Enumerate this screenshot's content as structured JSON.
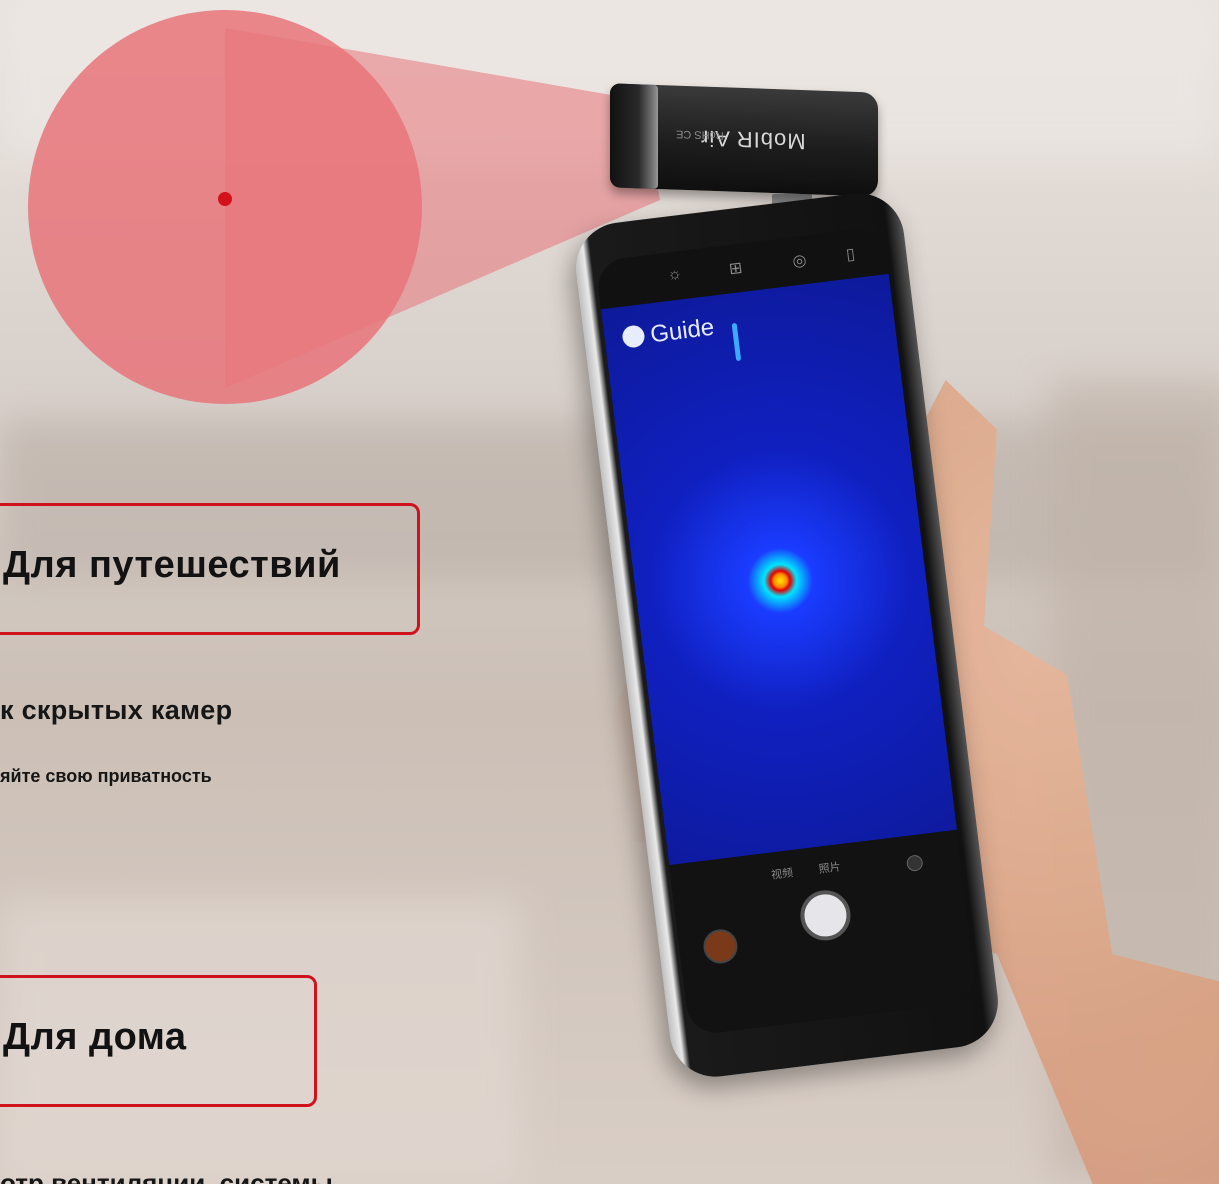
{
  "device": {
    "module_brand": "MobIR Air",
    "module_marks": "RoHS CE",
    "app_logo": "Guide",
    "app_modes": [
      "视频",
      "照片"
    ]
  },
  "captions": {
    "travel_title": "Для путешествий",
    "hidden_cameras": "к скрытых камер",
    "privacy": "яйте свою приватность",
    "home_title": "Для дома",
    "ventilation": "отр вентиляции, системы"
  },
  "colors": {
    "accent_border": "#d0121c",
    "beam": "#e8747a",
    "laser_dot": "#d3121c",
    "thermal_background": "#1020c0"
  },
  "icons": [
    "brightness-icon",
    "grid-icon",
    "palette-icon",
    "battery-icon",
    "shutter-icon",
    "gallery-icon",
    "flip-camera-icon"
  ]
}
